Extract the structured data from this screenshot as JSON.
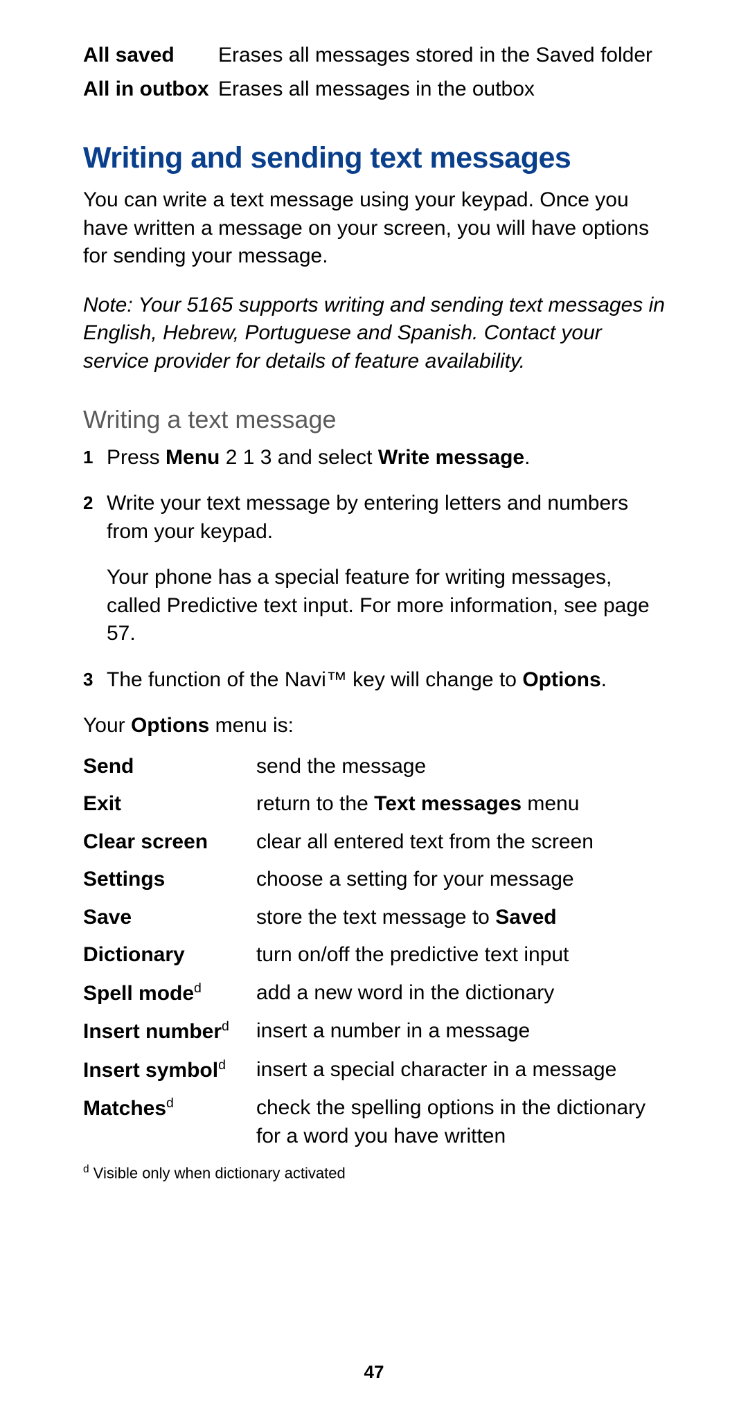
{
  "top_rows": [
    {
      "label": "All saved",
      "desc": "Erases all messages stored in the Saved folder"
    },
    {
      "label": "All in outbox",
      "desc": "Erases all messages in the outbox"
    }
  ],
  "heading": "Writing and sending text messages",
  "intro": "You can write a text message using your keypad. Once you have written a message on your screen, you will have options for sending your message.",
  "note": "Note: Your 5165  supports writing and sending text messages in English, Hebrew, Portuguese and Spanish. Contact your service provider for details of feature availability.",
  "subheading": "Writing a text message",
  "steps": {
    "s1": {
      "num": "1",
      "pre": "Press ",
      "bold1": "Menu",
      "mid": " 2 1 3 and select ",
      "bold2": "Write message",
      "post": "."
    },
    "s2": {
      "num": "2",
      "text": "Write your text message by entering letters and numbers from your keypad.",
      "extra": "Your phone has a special feature for writing messages, called Predictive text input. For more information, see page 57."
    },
    "s3": {
      "num": "3",
      "pre": "The function of the Navi™ key will change to ",
      "bold": "Options",
      "post": "."
    }
  },
  "lead_pre": "Your ",
  "lead_bold": "Options",
  "lead_post": " menu is:",
  "options": [
    {
      "label": "Send",
      "sup": "",
      "desc_pre": "send the message",
      "desc_bold": "",
      "desc_post": ""
    },
    {
      "label": "Exit",
      "sup": "",
      "desc_pre": "return to the ",
      "desc_bold": "Text messages",
      "desc_post": " menu"
    },
    {
      "label": "Clear screen",
      "sup": "",
      "desc_pre": "clear all entered text from the screen",
      "desc_bold": "",
      "desc_post": ""
    },
    {
      "label": "Settings",
      "sup": "",
      "desc_pre": "choose a setting for your message",
      "desc_bold": "",
      "desc_post": ""
    },
    {
      "label": "Save",
      "sup": "",
      "desc_pre": "store the text message to ",
      "desc_bold": "Saved",
      "desc_post": ""
    },
    {
      "label": "Dictionary",
      "sup": "",
      "desc_pre": "turn on/off the predictive text input",
      "desc_bold": "",
      "desc_post": ""
    },
    {
      "label": "Spell mode",
      "sup": "d",
      "desc_pre": "add a new word in the dictionary",
      "desc_bold": "",
      "desc_post": ""
    },
    {
      "label": "Insert number",
      "sup": "d",
      "desc_pre": "insert a number in a message",
      "desc_bold": "",
      "desc_post": ""
    },
    {
      "label": "Insert symbol",
      "sup": "d",
      "desc_pre": "insert a special character in a message",
      "desc_bold": "",
      "desc_post": ""
    },
    {
      "label": "Matches",
      "sup": "d",
      "desc_pre": "check the spelling options in the dictionary for a word you have written",
      "desc_bold": "",
      "desc_post": ""
    }
  ],
  "footnote_sup": "d",
  "footnote_text": " Visible only when dictionary activated",
  "page_number": "47"
}
